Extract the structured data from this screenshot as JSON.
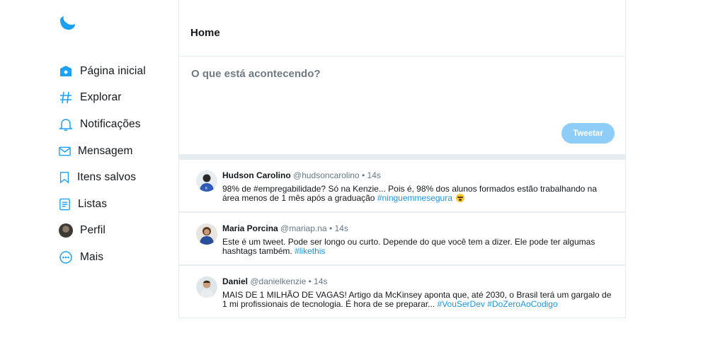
{
  "app": {
    "accent": "#1da1f2",
    "logo_icon": "bird-logo-icon"
  },
  "sidebar": {
    "items": [
      {
        "label": "Página inicial",
        "icon": "home-icon"
      },
      {
        "label": "Explorar",
        "icon": "hashtag-icon"
      },
      {
        "label": "Notificações",
        "icon": "bell-icon"
      },
      {
        "label": "Mensagem",
        "icon": "envelope-icon"
      },
      {
        "label": "Itens salvos",
        "icon": "bookmark-icon"
      },
      {
        "label": "Listas",
        "icon": "list-icon"
      },
      {
        "label": "Perfil",
        "icon": "profile-avatar-icon"
      },
      {
        "label": "Mais",
        "icon": "more-icon"
      }
    ]
  },
  "header": {
    "title": "Home"
  },
  "compose": {
    "placeholder": "O que está acontecendo?",
    "button_label": "Tweetar",
    "button_color": "#8ecdf8"
  },
  "tweets": [
    {
      "name": "Hudson Carolino",
      "handle": "@hudsoncarolino",
      "separator": "•",
      "time": "14s",
      "text": "98% de #empregabilidade? Só na Kenzie... Pois é, 98% dos alunos formados estão trabalhando na área menos de 1 mês após a graduação ",
      "hashtag": "#ninguemmesegura"
    },
    {
      "name": "Maria Porcina",
      "handle": "@mariap.na",
      "separator": "•",
      "time": "14s",
      "text": "Este é um tweet. Pode ser longo ou curto. Depende do que você tem a dizer. Ele pode ter algumas hashtags também. ",
      "hashtag": "#likethis"
    },
    {
      "name": "Daniel",
      "handle": "@danielkenzie",
      "separator": "•",
      "time": "14s",
      "text": "MAIS DE 1 MILHÃO DE VAGAS! Artigo da McKinsey aponta que, até 2030, o Brasil terá um gargalo de 1 mi profissionais de tecnologia. É hora de se preparar... ",
      "hashtag": "#VouSerDev",
      "hashtag2": "#DoZeroAoCodigo"
    }
  ]
}
